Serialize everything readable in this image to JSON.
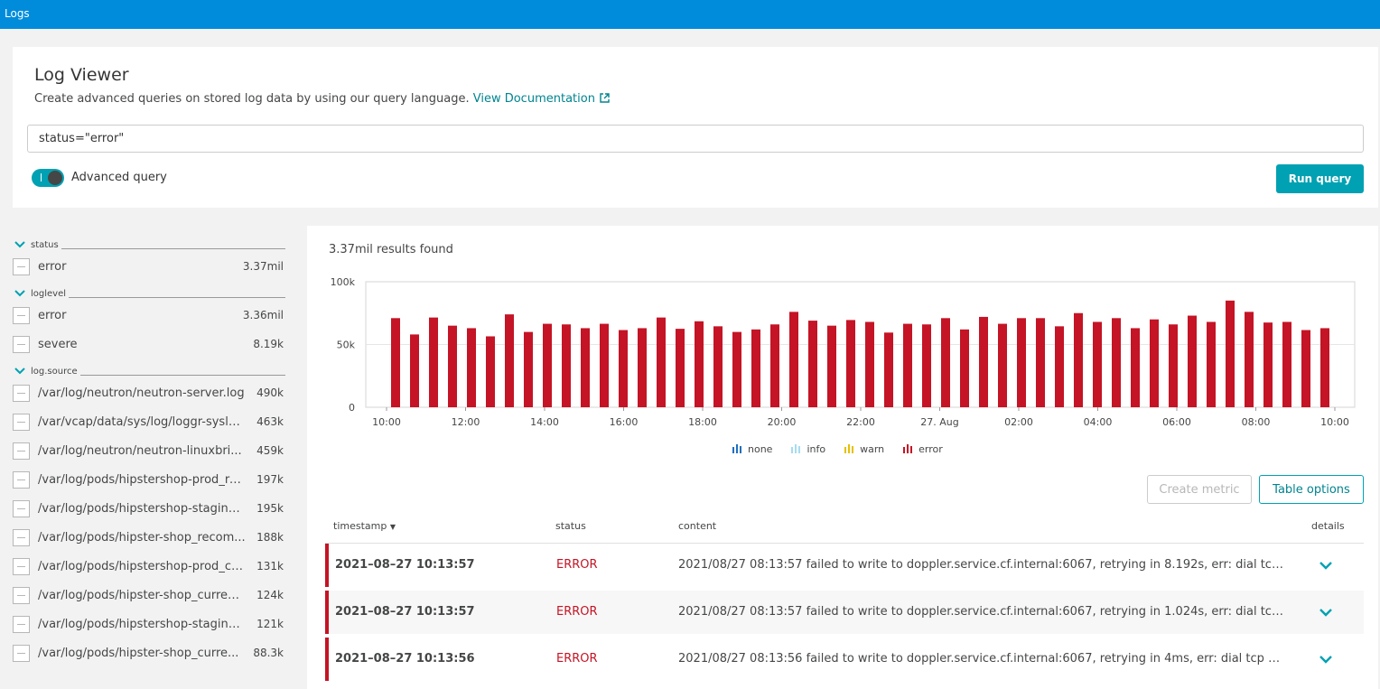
{
  "app": {
    "title": "Logs"
  },
  "query_panel": {
    "title": "Log Viewer",
    "description": "Create advanced queries on stored log data by using our query language.",
    "doc_link": "View Documentation",
    "query_value": "status=\"error\"",
    "toggle_label": "Advanced query",
    "advanced_query_enabled": true,
    "run_button": "Run query"
  },
  "facets": [
    {
      "name": "status",
      "items": [
        {
          "label": "error",
          "count": "3.37mil"
        }
      ]
    },
    {
      "name": "loglevel",
      "items": [
        {
          "label": "error",
          "count": "3.36mil"
        },
        {
          "label": "severe",
          "count": "8.19k"
        }
      ]
    },
    {
      "name": "log.source",
      "items": [
        {
          "label": "/var/log/neutron/neutron-server.log",
          "count": "490k"
        },
        {
          "label": "/var/vcap/data/sys/log/loggr-syslo...",
          "count": "463k"
        },
        {
          "label": "/var/log/neutron/neutron-linuxbri...",
          "count": "459k"
        },
        {
          "label": "/var/log/pods/hipstershop-prod_re...",
          "count": "197k"
        },
        {
          "label": "/var/log/pods/hipstershop-staging...",
          "count": "195k"
        },
        {
          "label": "/var/log/pods/hipster-shop_recom...",
          "count": "188k"
        },
        {
          "label": "/var/log/pods/hipstershop-prod_cu...",
          "count": "131k"
        },
        {
          "label": "/var/log/pods/hipster-shop_curren...",
          "count": "124k"
        },
        {
          "label": "/var/log/pods/hipstershop-staging_...",
          "count": "121k"
        },
        {
          "label": "/var/log/pods/hipster-shop_curre...",
          "count": "88.3k"
        }
      ]
    }
  ],
  "results": {
    "count_text": "3.37mil results found",
    "create_metric_button": "Create metric",
    "table_options_button": "Table options",
    "columns": {
      "timestamp": "timestamp",
      "status": "status",
      "content": "content",
      "details": "details"
    },
    "rows": [
      {
        "timestamp": "2021–08–27 10:13:57",
        "status": "ERROR",
        "content": "2021/08/27 08:13:57 failed to write to doppler.service.cf.internal:6067, retrying in 8.192s, err: dial tcp 1..."
      },
      {
        "timestamp": "2021–08–27 10:13:57",
        "status": "ERROR",
        "content": "2021/08/27 08:13:57 failed to write to doppler.service.cf.internal:6067, retrying in 1.024s, err: dial tcp 1..."
      },
      {
        "timestamp": "2021–08–27 10:13:56",
        "status": "ERROR",
        "content": "2021/08/27 08:13:56 failed to write to doppler.service.cf.internal:6067, retrying in 4ms, err: dial tcp 10.0..."
      }
    ]
  },
  "colors": {
    "accent": "#00a1b2",
    "link": "#00848f",
    "error": "#c41425",
    "none": "#1f6fbf",
    "info": "#a6dcf0",
    "warn": "#e6c000",
    "topbar": "#008cdb"
  },
  "chart_data": {
    "type": "bar",
    "ylim": [
      0,
      100000
    ],
    "y_ticks": [
      "0",
      "50k",
      "100k"
    ],
    "x_tick_labels": [
      "10:00",
      "12:00",
      "14:00",
      "16:00",
      "18:00",
      "20:00",
      "22:00",
      "27. Aug",
      "02:00",
      "04:00",
      "06:00",
      "08:00",
      "10:00"
    ],
    "grid": true,
    "legend_position": "bottom",
    "series": [
      {
        "name": "none",
        "values": []
      },
      {
        "name": "info",
        "values": []
      },
      {
        "name": "warn",
        "values": []
      },
      {
        "name": "error",
        "values": [
          71000,
          58000,
          71500,
          65000,
          63000,
          56500,
          74000,
          60000,
          66500,
          66000,
          63000,
          66500,
          61500,
          63000,
          71500,
          62500,
          68500,
          64500,
          60000,
          62000,
          66000,
          76000,
          69000,
          65000,
          69500,
          68000,
          59500,
          66500,
          66000,
          71000,
          62000,
          72000,
          66500,
          71000,
          71000,
          64500,
          75000,
          68000,
          71000,
          63000,
          70000,
          66000,
          73000,
          68000,
          85000,
          76000,
          67500,
          68000,
          61500,
          63000
        ]
      }
    ]
  }
}
